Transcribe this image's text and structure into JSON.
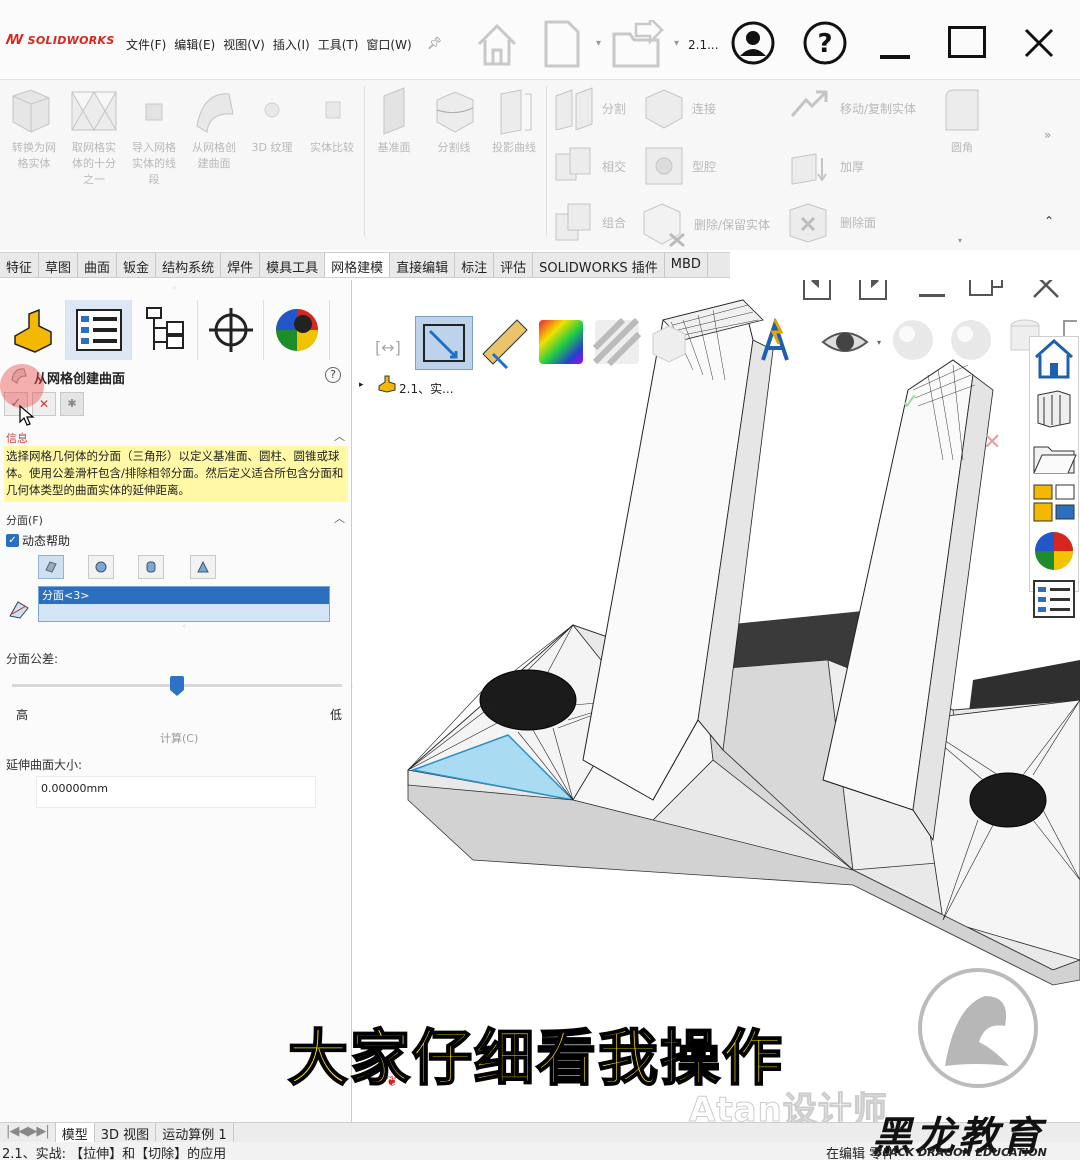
{
  "app": {
    "logo": "SOLIDWORKS"
  },
  "menu": [
    "文件(F)",
    "编辑(E)",
    "视图(V)",
    "插入(I)",
    "工具(T)",
    "窗口(W)"
  ],
  "titlebar": {
    "doc_name": "2.1..."
  },
  "ribbon": {
    "tools": [
      {
        "label1": "转换为网",
        "label2": "格实体"
      },
      {
        "label1": "取网格实",
        "label2": "体的十分",
        "label3": "之一"
      },
      {
        "label1": "导入网格",
        "label2": "实体的线",
        "label3": "段"
      },
      {
        "label1": "从网格创",
        "label2": "建曲面"
      },
      {
        "label1": "3D 纹理"
      },
      {
        "label1": "实体比较"
      },
      {
        "label1": "基准面"
      },
      {
        "label1": "分割线"
      },
      {
        "label1": "投影曲线"
      }
    ],
    "rows": {
      "split": "分割",
      "connect": "连接",
      "move_copy": "移动/复制实体",
      "intersect": "相交",
      "cavity": "型腔",
      "thicken": "加厚",
      "combine": "组合",
      "delete_keep": "删除/保留实体",
      "delete_face": "删除面",
      "fillet": "圆角",
      "more": "»"
    }
  },
  "tabs": [
    "特征",
    "草图",
    "曲面",
    "钣金",
    "结构系统",
    "焊件",
    "模具工具",
    "网格建模",
    "直接编辑",
    "标注",
    "评估",
    "SOLIDWORKS 插件",
    "MBD"
  ],
  "active_tab": "网格建模",
  "panel": {
    "title": "从网格创建曲面",
    "help": "?",
    "ok": "✓",
    "cancel": "✕",
    "pin": "✱",
    "info_header": "信息",
    "info_text": "选择网格几何体的分面（三角形）以定义基准面、圆柱、圆锥或球体。使用公差滑杆包含/排除相邻分面。然后定义适合所包含分面和几何体类型的曲面实体的延伸距离。",
    "faces_header": "分面(F)",
    "dynamic_help": "动态帮助",
    "faces_item": "分面<3>",
    "tolerance_label": "分面公差:",
    "tolerance_value": 0.5,
    "high": "高",
    "low": "低",
    "calc_button": "计算(C)",
    "extend_label": "延伸曲面大小:",
    "extend_value": "0.00000mm"
  },
  "tree": {
    "root": "2.1、实..."
  },
  "subtitle": "大家仔细看我操作",
  "watermark": {
    "author": "Atan设计师",
    "brand": "黑龙教育",
    "brand_en": "BLACK DRAGON EDUCATION"
  },
  "bottom_tabs": [
    "模型",
    "3D 视图",
    "运动算例 1"
  ],
  "status": {
    "left": "2.1、实战: 【拉伸】和【切除】的应用",
    "right": "在编辑 零件"
  }
}
